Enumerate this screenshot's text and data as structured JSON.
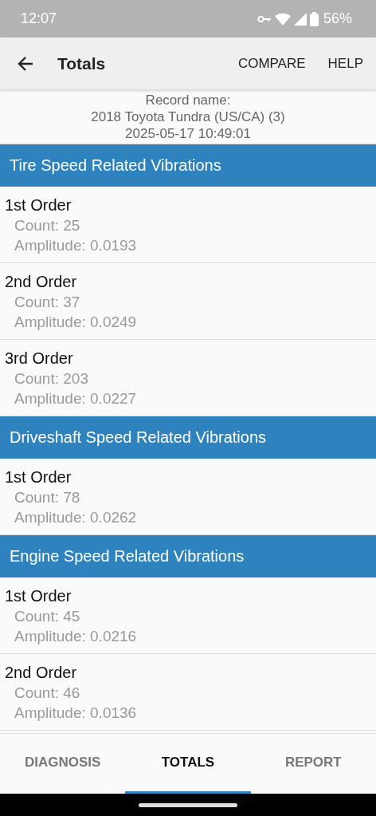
{
  "status_bar": {
    "time": "12:07",
    "battery": "56%"
  },
  "app_bar": {
    "title": "Totals",
    "actions": [
      "COMPARE",
      "HELP"
    ]
  },
  "record": {
    "label": "Record name:",
    "name": "2018 Toyota Tundra (US/CA) (3)",
    "date": "2025-05-17 10:49:01"
  },
  "sections": [
    {
      "title": "Tire Speed Related Vibrations",
      "orders": [
        {
          "name": "1st Order",
          "count": "Count: 25",
          "amplitude": "Amplitude: 0.0193"
        },
        {
          "name": "2nd Order",
          "count": "Count: 37",
          "amplitude": "Amplitude: 0.0249"
        },
        {
          "name": "3rd Order",
          "count": "Count: 203",
          "amplitude": "Amplitude: 0.0227"
        }
      ]
    },
    {
      "title": "Driveshaft Speed Related Vibrations",
      "orders": [
        {
          "name": "1st Order",
          "count": "Count: 78",
          "amplitude": "Amplitude: 0.0262"
        }
      ]
    },
    {
      "title": "Engine Speed Related Vibrations",
      "orders": [
        {
          "name": "1st Order",
          "count": "Count: 45",
          "amplitude": "Amplitude: 0.0216"
        },
        {
          "name": "2nd Order",
          "count": "Count: 46",
          "amplitude": "Amplitude: 0.0136"
        }
      ]
    }
  ],
  "tabs": [
    {
      "label": "DIAGNOSIS",
      "selected": false
    },
    {
      "label": "TOTALS",
      "selected": true
    },
    {
      "label": "REPORT",
      "selected": false
    }
  ]
}
